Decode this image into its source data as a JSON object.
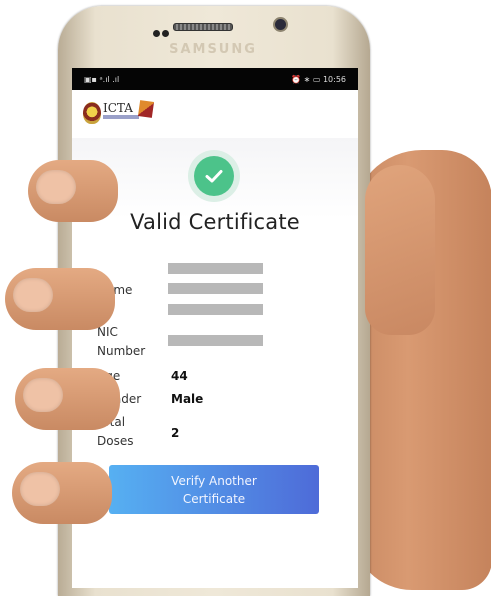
{
  "device": {
    "brand": "SAMSUNG"
  },
  "statusbar": {
    "left": "▣▪ ᵃ.ıl .ıl",
    "right": "⏰ ∗ ▭ 10:56"
  },
  "header": {
    "logo_text": "ICTA"
  },
  "result": {
    "title": "Valid Certificate"
  },
  "fields": {
    "name_label": "Name",
    "nic_label_1": "NIC",
    "nic_label_2": "Number",
    "age_label": "Age",
    "age_value": "44",
    "gender_label": "Gender",
    "gender_value": "Male",
    "doses_label_1": "Total",
    "doses_label_2": "Doses",
    "doses_value": "2"
  },
  "actions": {
    "verify_line_1": "Verify Another",
    "verify_line_2": "Certificate"
  },
  "colors": {
    "accent_start": "#56b0f2",
    "accent_end": "#4e6bd8",
    "success": "#4cc38a"
  },
  "icons": [
    "check-icon",
    "icta-logo-icon"
  ]
}
